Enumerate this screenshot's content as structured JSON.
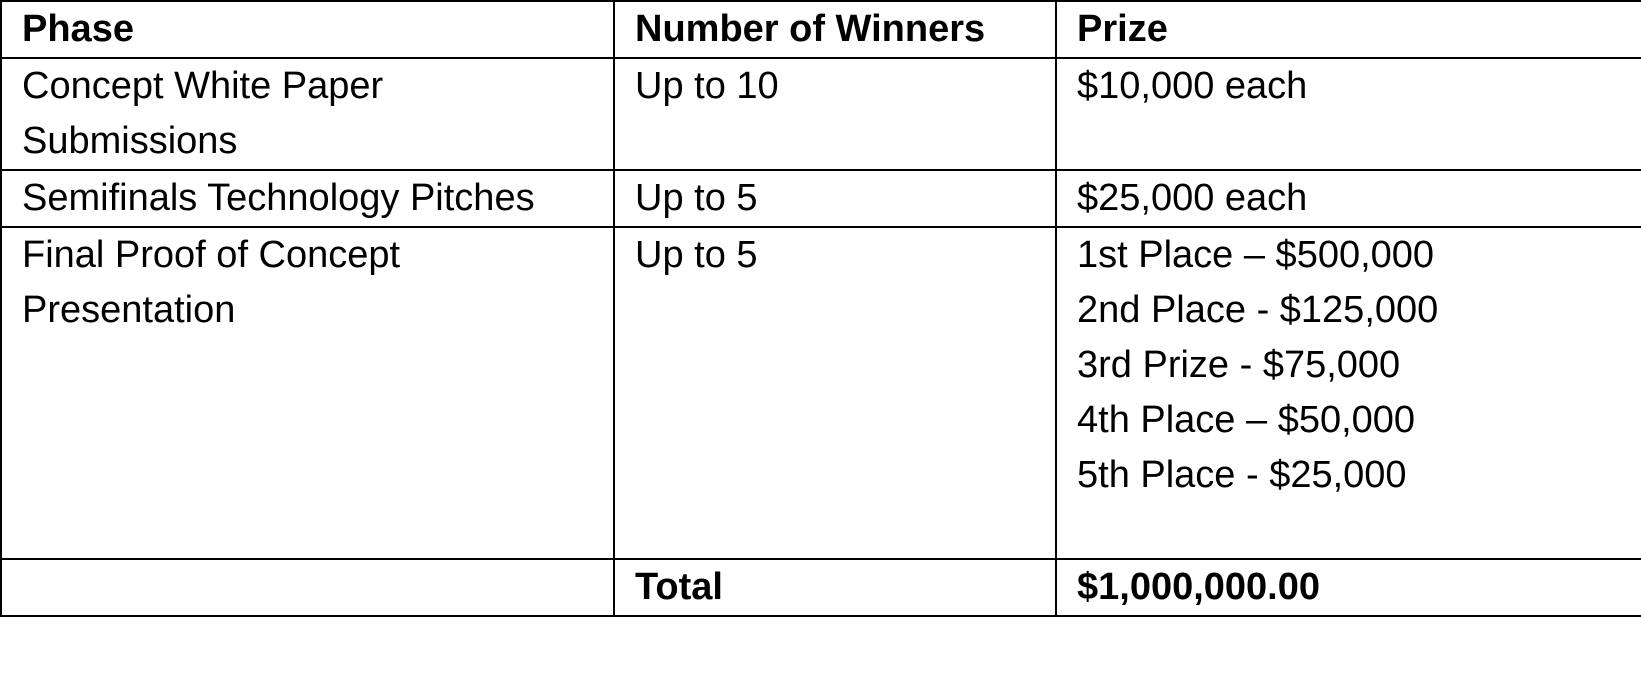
{
  "table": {
    "headers": {
      "phase": "Phase",
      "winners": "Number of Winners",
      "prize": "Prize"
    },
    "rows": [
      {
        "phase": "Concept White Paper Submissions",
        "winners": "Up to 10",
        "prize": [
          "$10,000 each"
        ]
      },
      {
        "phase": "Semifinals Technology Pitches",
        "winners": "Up to 5",
        "prize": [
          "$25,000 each"
        ]
      },
      {
        "phase": "Final Proof of Concept Presentation",
        "winners": "Up to 5",
        "prize": [
          "1st Place – $500,000",
          "2nd Place - $125,000",
          "3rd Prize - $75,000",
          "4th Place – $50,000",
          "5th Place - $25,000"
        ]
      }
    ],
    "total": {
      "phase": "",
      "label": "Total",
      "amount": "$1,000,000.00"
    }
  }
}
